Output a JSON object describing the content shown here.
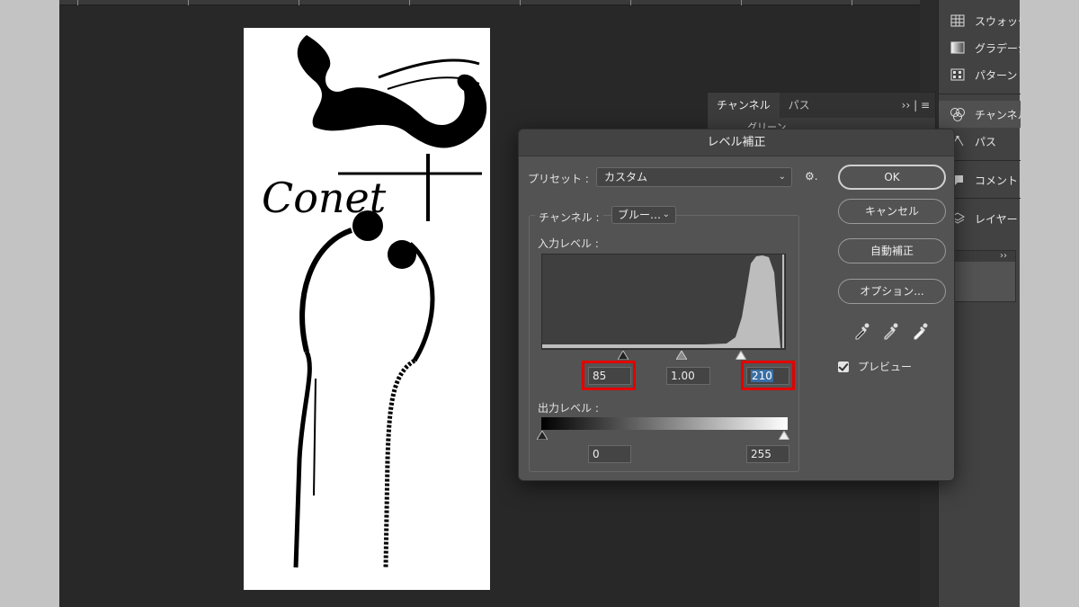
{
  "panels": {
    "items": [
      {
        "label": "スウォッチ",
        "icon": "swatches-icon"
      },
      {
        "label": "グラデーション",
        "icon": "gradient-icon"
      },
      {
        "label": "パターン",
        "icon": "pattern-icon"
      },
      {
        "label": "チャンネル",
        "icon": "channels-icon"
      },
      {
        "label": "パス",
        "icon": "paths-icon"
      },
      {
        "label": "コメント",
        "icon": "comment-icon"
      },
      {
        "label": "レイヤー",
        "icon": "layers-icon"
      }
    ],
    "mini_expand": "››"
  },
  "channel_panel": {
    "tabs": [
      "チャンネル",
      "パス"
    ],
    "tools": "›› | ≡",
    "row_label": "グリーン"
  },
  "dialog": {
    "title": "レベル補正",
    "preset_label": "プリセット :",
    "preset_value": "カスタム",
    "preset_gear": "⚙.",
    "channel_label": "チャンネル :",
    "channel_value": "ブルー…",
    "input_label": "入力レベル :",
    "input_values": {
      "black": "85",
      "gamma": "1.00",
      "white": "210"
    },
    "output_label": "出力レベル :",
    "output_values": {
      "black": "0",
      "white": "255"
    },
    "buttons": {
      "ok": "OK",
      "cancel": "キャンセル",
      "auto": "自動補正",
      "options": "オプション..."
    },
    "preview_label": "プレビュー",
    "preview_checked": true,
    "highlight_color": "#e30000"
  },
  "document": {
    "text": "Conet"
  }
}
